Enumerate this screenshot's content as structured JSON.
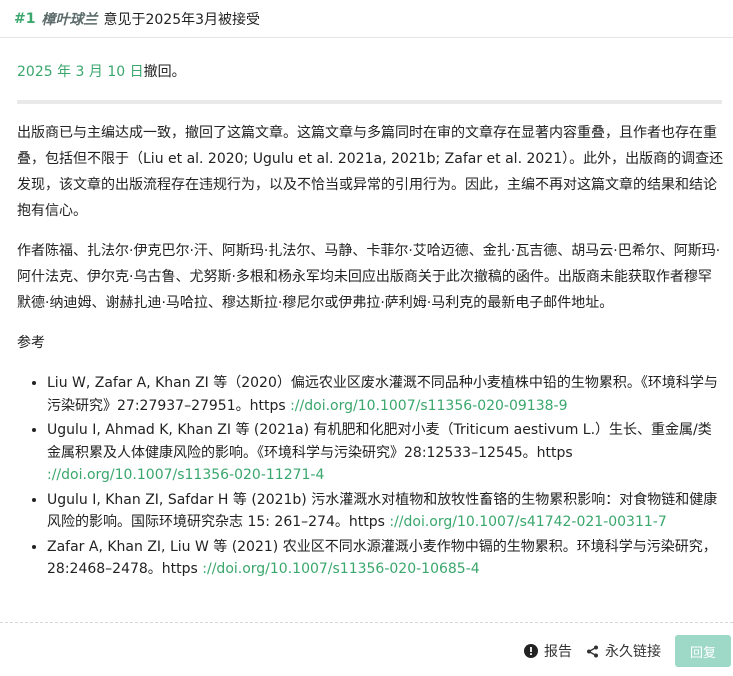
{
  "header": {
    "post_number": "#1",
    "username": "樟叶球兰",
    "title": "意见于2025年3月被接受"
  },
  "date_line": {
    "date_link": "2025 年 3 月 10 日",
    "suffix": "撤回。"
  },
  "body": {
    "paragraph1": "出版商已与主编达成一致，撤回了这篇文章。这篇文章与多篇同时在审的文章存在显著内容重叠，且作者也存在重叠，包括但不限于（Liu et al. 2020; Ugulu et al. 2021a, 2021b; Zafar et al. 2021）。此外，出版商的调查还发现，该文章的出版流程存在违规行为，以及不恰当或异常的引用行为。因此，主编不再对这篇文章的结果和结论抱有信心。",
    "paragraph2": "作者陈福、扎法尔·伊克巴尔·汗、阿斯玛·扎法尔、马静、卡菲尔·艾哈迈德、金扎·瓦吉德、胡马云·巴希尔、阿斯玛·阿什法克、伊尔克·乌古鲁、尤努斯·多根和杨永军均未回应出版商关于此次撤稿的函件。出版商未能获取作者穆罕默德·纳迪姆、谢赫扎迪·马哈拉、穆达斯拉·穆尼尔或伊弗拉·萨利姆·马利克的最新电子邮件地址。",
    "refs_heading": "参考"
  },
  "references": [
    {
      "text": "Liu W, Zafar A, Khan ZI 等（2020）偏远农业区废水灌溉不同品种小麦植株中铅的生物累积。《环境科学与污染研究》27:27937–27951。https ",
      "link": "://doi.org/10.1007/s11356-020-09138-9"
    },
    {
      "text": "Ugulu I, Ahmad K, Khan ZI 等 (2021a) 有机肥和化肥对小麦（Triticum aestivum L.）生长、重金属/类金属积累及人体健康风险的影响。《环境科学与污染研究》28:12533–12545。https ",
      "link": "://doi.org/10.1007/s11356-020-11271-4"
    },
    {
      "text": "Ugulu I, Khan ZI, Safdar H 等 (2021b) 污水灌溉水对植物和放牧性畜铬的生物累积影响：对食物链和健康风险的影响。国际环境研究杂志 15: 261–274。https ",
      "link": "://doi.org/10.1007/s41742-021-00311-7"
    },
    {
      "text": "Zafar A, Khan ZI, Liu W 等 (2021) 农业区不同水源灌溉小麦作物中镉的生物累积。环境科学与污染研究，28:2468–2478。https ",
      "link": "://doi.org/10.1007/s11356-020-10685-4"
    }
  ],
  "footer": {
    "report_label": "报告",
    "permalink_label": "永久链接",
    "reply_label": "回复"
  },
  "colors": {
    "accent": "#3aa76d",
    "reply_button": "#9ed8c6",
    "username": "#5d6b6b"
  },
  "icons": {
    "report": "exclamation-circle-icon",
    "permalink": "share-icon"
  }
}
